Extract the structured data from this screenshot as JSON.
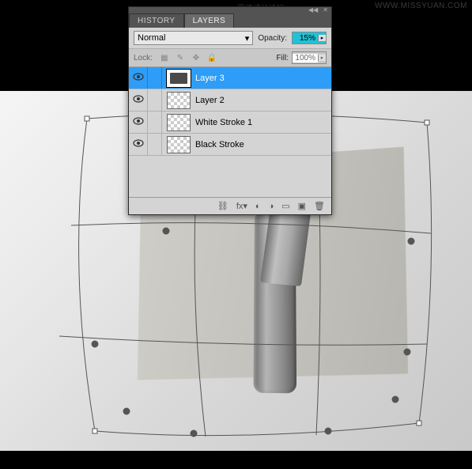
{
  "watermark": {
    "cn": "思缘设计论坛",
    "url": "WWW.MISSYUAN.COM"
  },
  "panel": {
    "tabs": {
      "history": "HISTORY",
      "layers": "LAYERS"
    },
    "blend_mode": "Normal",
    "opacity": {
      "label": "Opacity:",
      "value": "15%"
    },
    "lock": {
      "label": "Lock:"
    },
    "fill": {
      "label": "Fill:",
      "value": "100%"
    },
    "layers": [
      {
        "name": "Layer 3"
      },
      {
        "name": "Layer 2"
      },
      {
        "name": "White Stroke 1"
      },
      {
        "name": "Black Stroke"
      }
    ]
  }
}
